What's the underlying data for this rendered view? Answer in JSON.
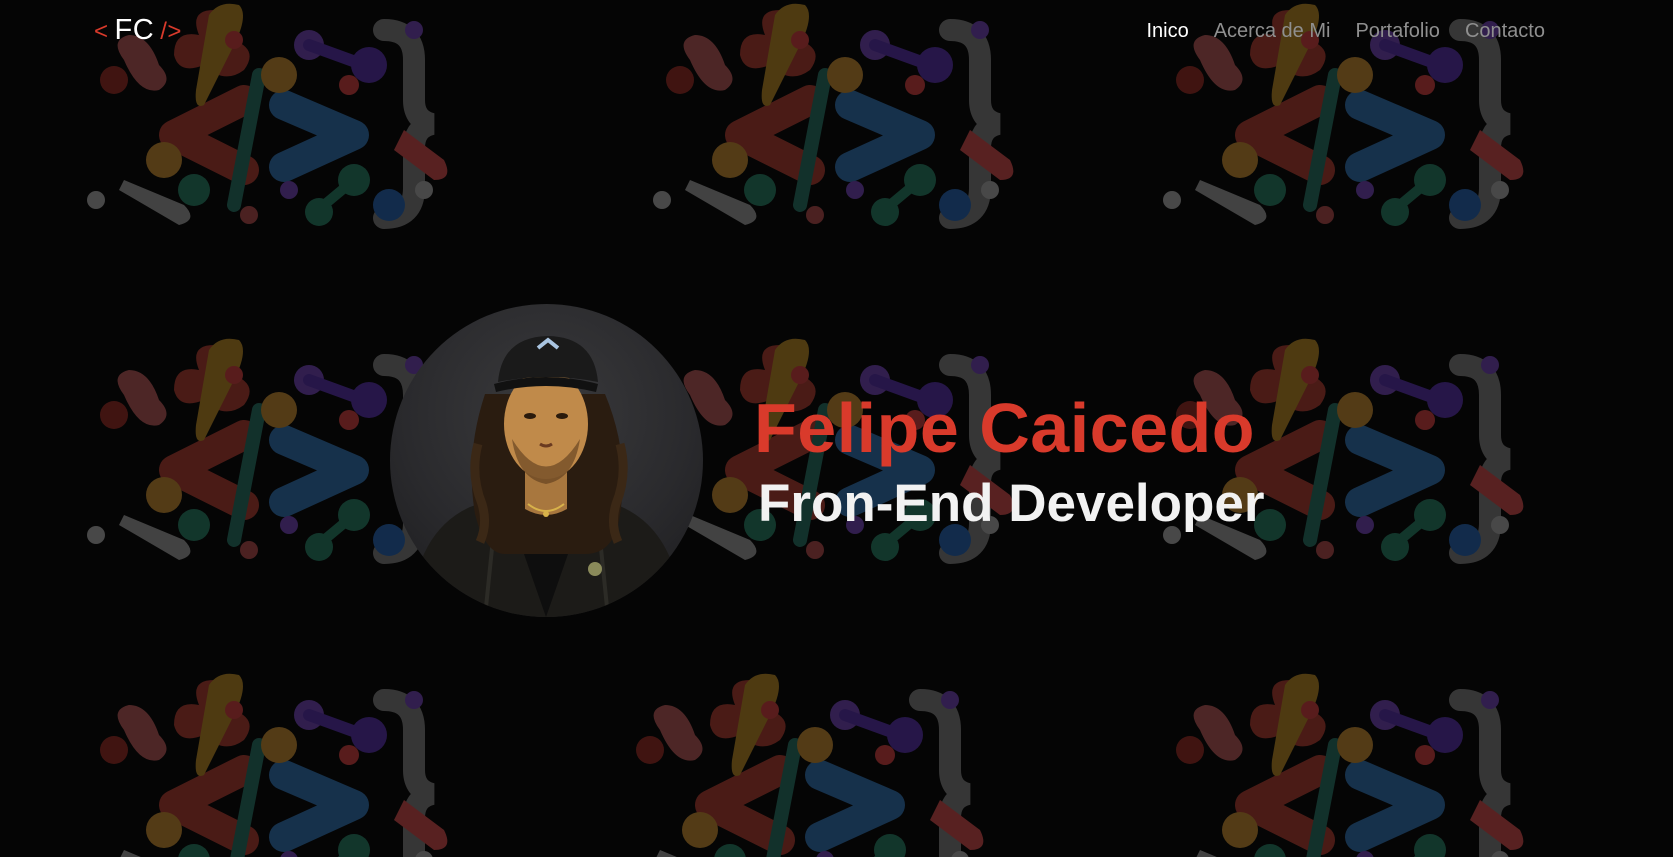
{
  "logo": {
    "open_bracket": "<",
    "initials": "FC",
    "close_bracket": "/>"
  },
  "nav": {
    "items": [
      {
        "label": "Inico",
        "active": true
      },
      {
        "label": "Acerca de Mi",
        "active": false
      },
      {
        "label": "Portafolio",
        "active": false
      },
      {
        "label": "Contacto",
        "active": false
      }
    ]
  },
  "hero": {
    "name": "Felipe Caicedo",
    "role": "Fron-End Developer",
    "avatar_icon": "profile-photo"
  },
  "colors": {
    "accent": "#d93a2b",
    "background": "#050505",
    "nav_inactive": "#8f8f8f",
    "text": "#ffffff"
  }
}
